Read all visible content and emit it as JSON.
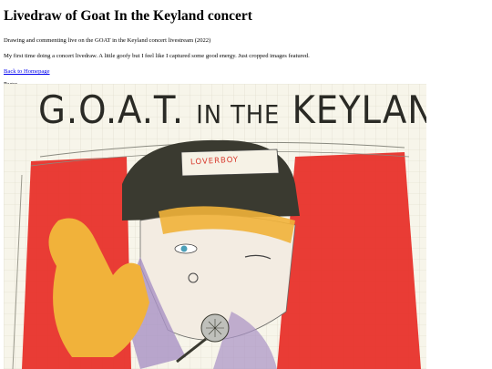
{
  "header": {
    "title": "Livedraw of Goat In the Keyland concert",
    "subtitle": "Drawing and commenting live on the GOAT in the Keyland concert livestream (2022)",
    "description": "My first time doing a concert livedraw. A little goofy but I feel like I captured some good energy. Just cropped images featured."
  },
  "nav": {
    "back_link": "Back to Homepage"
  },
  "section": {
    "label": "Pages"
  },
  "artwork": {
    "title_part1": "G.O.A.T.",
    "title_part2": "IN THE",
    "title_part3": "KEYLAND",
    "hat_text": "LOVERBOY"
  },
  "colors": {
    "link": "#0000ee",
    "red": "#e8322b",
    "yellow": "#f1b23a",
    "dark": "#3a3a30"
  }
}
